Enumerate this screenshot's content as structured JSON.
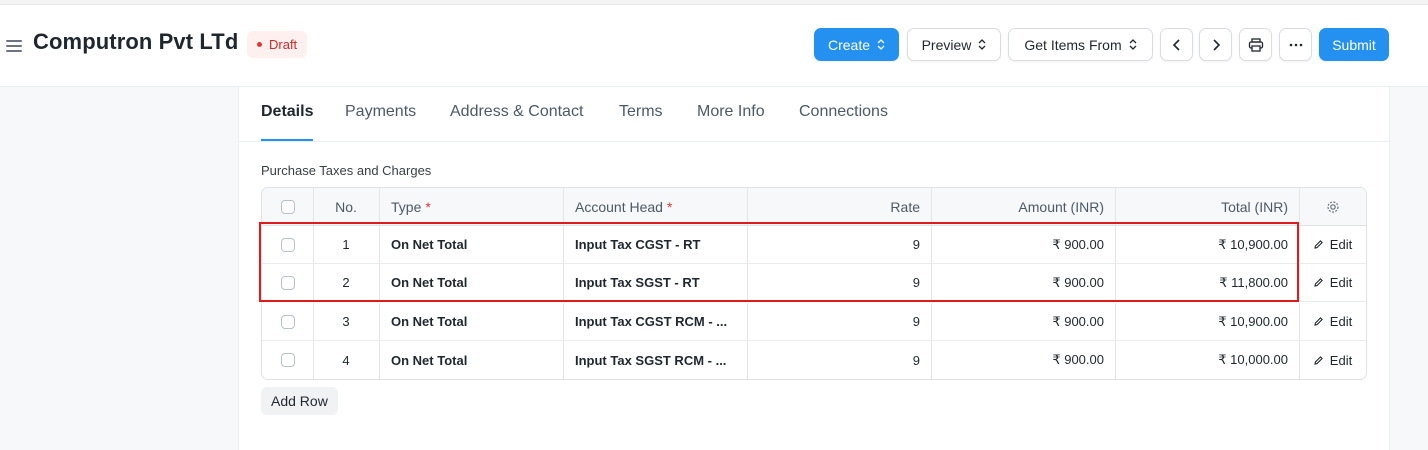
{
  "header": {
    "title": "Computron Pvt LTd",
    "status": "Draft",
    "status_color": "#cc2929",
    "buttons": {
      "create": "Create",
      "preview": "Preview",
      "get_items_from": "Get Items From",
      "submit": "Submit"
    },
    "accent_color": "#2490ef"
  },
  "tabs": [
    {
      "label": "Details",
      "active": true
    },
    {
      "label": "Payments",
      "active": false
    },
    {
      "label": "Address & Contact",
      "active": false
    },
    {
      "label": "Terms",
      "active": false
    },
    {
      "label": "More Info",
      "active": false
    },
    {
      "label": "Connections",
      "active": false
    }
  ],
  "section": {
    "label": "Purchase Taxes and Charges"
  },
  "table": {
    "columns": {
      "no": "No.",
      "type": "Type",
      "account_head": "Account Head",
      "rate": "Rate",
      "amount": "Amount (INR)",
      "total": "Total (INR)"
    },
    "required_marker": "*",
    "edit_label": "Edit",
    "rows": [
      {
        "no": "1",
        "type": "On Net Total",
        "account_head": "Input Tax CGST - RT",
        "rate": "9",
        "amount": "₹ 900.00",
        "total": "₹ 10,900.00"
      },
      {
        "no": "2",
        "type": "On Net Total",
        "account_head": "Input Tax SGST - RT",
        "rate": "9",
        "amount": "₹ 900.00",
        "total": "₹ 11,800.00"
      },
      {
        "no": "3",
        "type": "On Net Total",
        "account_head": "Input Tax CGST RCM - ...",
        "rate": "9",
        "amount": "₹ 900.00",
        "total": "₹ 10,900.00"
      },
      {
        "no": "4",
        "type": "On Net Total",
        "account_head": "Input Tax SGST RCM - ...",
        "rate": "9",
        "amount": "₹ 900.00",
        "total": "₹ 10,000.00"
      }
    ],
    "add_row_label": "Add Row"
  },
  "icons": {
    "menu": "hamburger-icon",
    "prev": "chevron-left-icon",
    "next": "chevron-right-icon",
    "print": "printer-icon",
    "more": "ellipsis-icon",
    "settings": "gear-icon",
    "edit": "pencil-icon"
  }
}
